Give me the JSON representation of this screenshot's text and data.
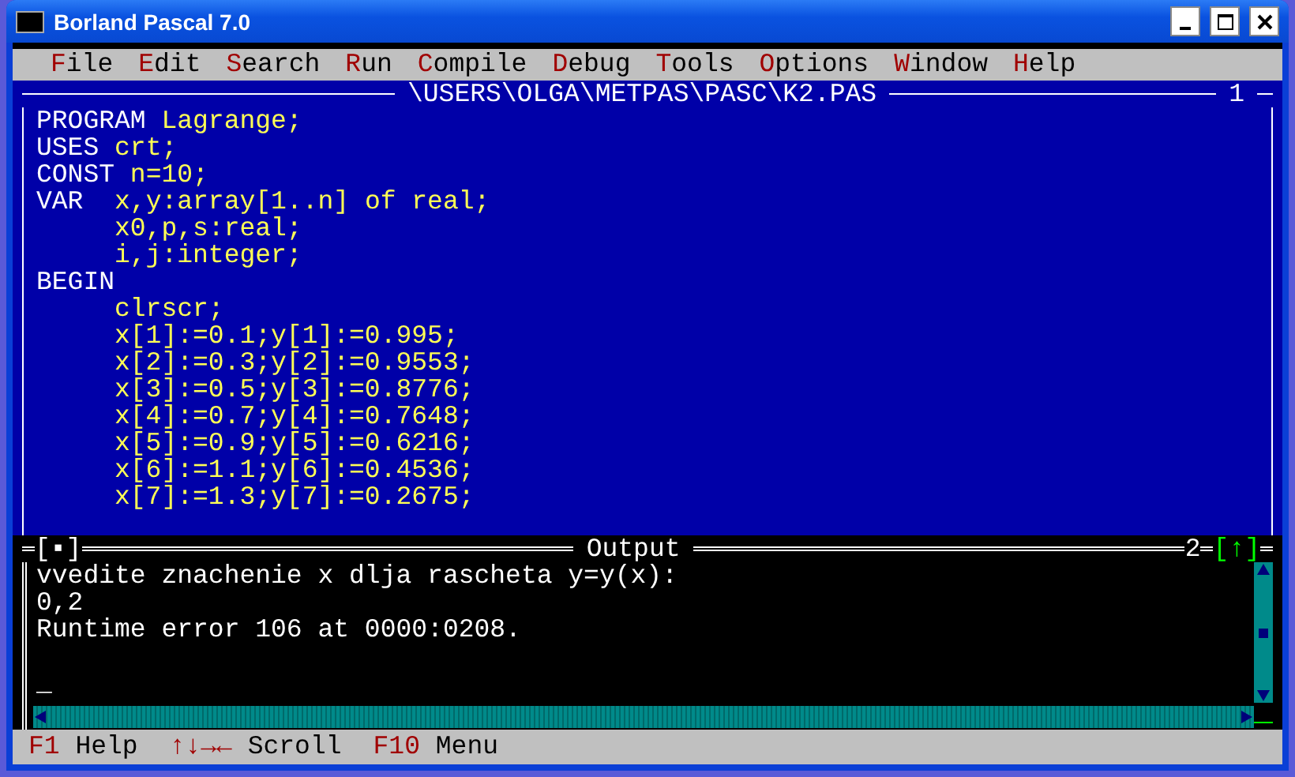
{
  "window": {
    "title": "Borland Pascal 7.0"
  },
  "menu": [
    {
      "hotkey": "F",
      "rest": "ile"
    },
    {
      "hotkey": "E",
      "rest": "dit"
    },
    {
      "hotkey": "S",
      "rest": "earch"
    },
    {
      "hotkey": "R",
      "rest": "un"
    },
    {
      "hotkey": "C",
      "rest": "ompile"
    },
    {
      "hotkey": "D",
      "rest": "ebug"
    },
    {
      "hotkey": "T",
      "rest": "ools"
    },
    {
      "hotkey": "O",
      "rest": "ptions"
    },
    {
      "hotkey": "W",
      "rest": "indow"
    },
    {
      "hotkey": "H",
      "rest": "elp"
    }
  ],
  "editor": {
    "title": "\\USERS\\OLGA\\METPAS\\PASC\\K2.PAS",
    "number": "1",
    "lines": [
      {
        "keyword": "PROGRAM",
        "text": " Lagrange;"
      },
      {
        "keyword": "USES",
        "text": " crt;"
      },
      {
        "keyword": "CONST",
        "text": " n=10;"
      },
      {
        "keyword": "VAR",
        "text": "  x,y:array[1..n] of real;"
      },
      {
        "text": "     x0,p,s:real;"
      },
      {
        "text": "     i,j:integer;"
      },
      {
        "keyword": "BEGIN"
      },
      {
        "text": "     clrscr;"
      },
      {
        "text": "     x[1]:=0.1;y[1]:=0.995;"
      },
      {
        "text": "     x[2]:=0.3;y[2]:=0.9553;"
      },
      {
        "text": "     x[3]:=0.5;y[3]:=0.8776;"
      },
      {
        "text": "     x[4]:=0.7;y[4]:=0.7648;"
      },
      {
        "text": "     x[5]:=0.9;y[5]:=0.6216;"
      },
      {
        "text": "     x[6]:=1.1;y[6]:=0.4536;"
      },
      {
        "text": "     x[7]:=1.3;y[7]:=0.2675;"
      }
    ]
  },
  "output": {
    "title": "Output",
    "number": "2",
    "close": "[▪]",
    "zoom": "[↑]",
    "lines": [
      "vvedite znachenie x dlja rascheta y=y(x):",
      "0,2",
      "Runtime error 106 at 0000:0208."
    ],
    "cursor": "_"
  },
  "status_bar": [
    {
      "key": "F1",
      "label": "Help"
    },
    {
      "key": "↑↓→←",
      "label": "Scroll"
    },
    {
      "key": "F10",
      "label": "Menu"
    }
  ]
}
